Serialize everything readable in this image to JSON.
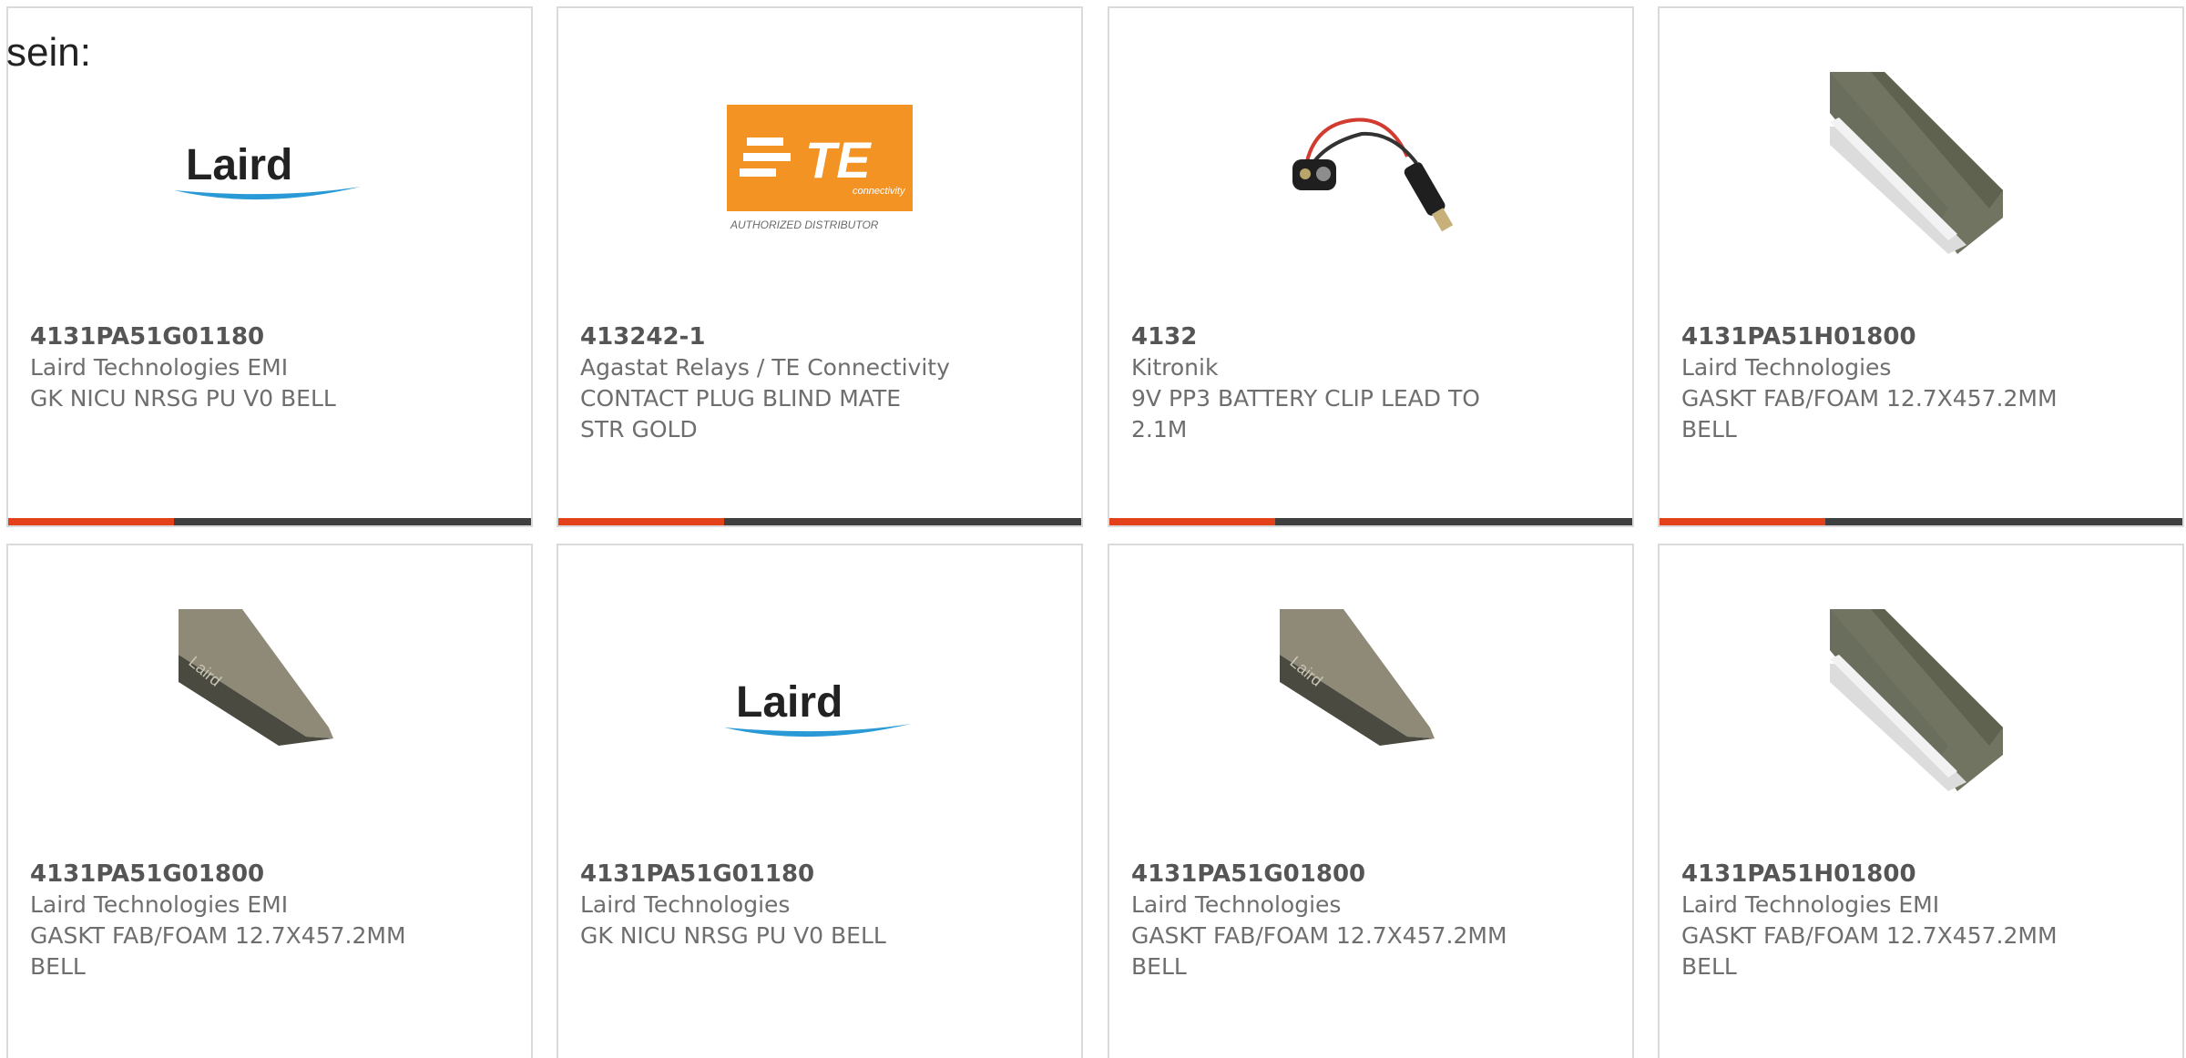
{
  "intro_text": "sein:",
  "colors": {
    "accent_bar": "#e2411a",
    "dark_bar": "#3f3f3f",
    "card_border": "#dadada",
    "te_orange": "#f39323",
    "laird_swoosh": "#2a9ad6"
  },
  "products": [
    {
      "part_number": "4131PA51G01180",
      "manufacturer": "Laird Technologies EMI",
      "desc1": "GK NICU NRSG PU V0 BELL",
      "desc2": "",
      "image": "laird-logo-icon"
    },
    {
      "part_number": "413242-1",
      "manufacturer": "Agastat Relays / TE Connectivity",
      "desc1": "CONTACT PLUG BLIND MATE",
      "desc2": "STR GOLD",
      "image": "te-connectivity-logo-icon",
      "logo_text": "TE",
      "logo_sub": "connectivity",
      "logo_caption": "AUTHORIZED DISTRIBUTOR"
    },
    {
      "part_number": "4132",
      "manufacturer": "Kitronik",
      "desc1": "9V PP3 BATTERY CLIP LEAD TO",
      "desc2": "2.1M",
      "image": "battery-clip-icon"
    },
    {
      "part_number": "4131PA51H01800",
      "manufacturer": "Laird Technologies",
      "desc1": "GASKT FAB/FOAM 12.7X457.2MM",
      "desc2": "BELL",
      "image": "gasket-strip-icon"
    },
    {
      "part_number": "4131PA51G01800",
      "manufacturer": "Laird Technologies EMI",
      "desc1": "GASKT FAB/FOAM 12.7X457.2MM",
      "desc2": "BELL",
      "image": "gasket-profile-icon"
    },
    {
      "part_number": "4131PA51G01180",
      "manufacturer": "Laird Technologies",
      "desc1": "GK NICU NRSG PU V0 BELL",
      "desc2": "",
      "image": "laird-logo-icon"
    },
    {
      "part_number": "4131PA51G01800",
      "manufacturer": "Laird Technologies",
      "desc1": "GASKT FAB/FOAM 12.7X457.2MM",
      "desc2": "BELL",
      "image": "gasket-profile-icon"
    },
    {
      "part_number": "4131PA51H01800",
      "manufacturer": "Laird Technologies EMI",
      "desc1": "GASKT FAB/FOAM 12.7X457.2MM",
      "desc2": "BELL",
      "image": "gasket-strip-icon"
    }
  ],
  "logos": {
    "laird": "Laird"
  }
}
